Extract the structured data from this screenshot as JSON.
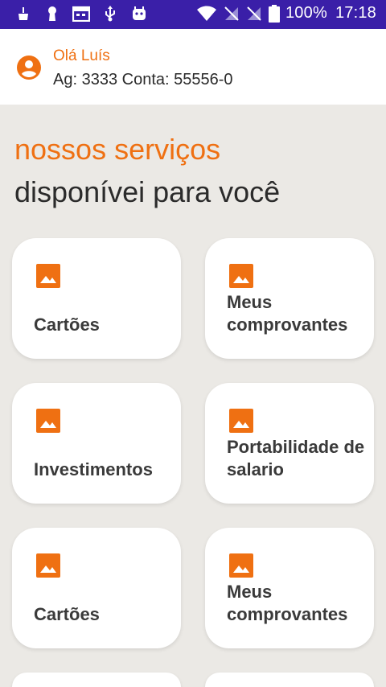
{
  "status_bar": {
    "icons_left": [
      "cleaning-icon",
      "keyhole-icon",
      "calendar-icon",
      "usb-icon",
      "android-icon"
    ],
    "icons_right": [
      "wifi-icon",
      "no-sim-icon",
      "no-sim-icon",
      "battery-icon"
    ],
    "battery": "100%",
    "time": "17:18"
  },
  "header": {
    "greeting": "Olá Luís",
    "account": "Ag: 3333 Conta: 55556-0",
    "accent_color": "#ef7012"
  },
  "section": {
    "title": "nossos serviços",
    "subtitle": "disponívei para você"
  },
  "services": [
    {
      "label": "Cartões"
    },
    {
      "label": "Meus comprovantes"
    },
    {
      "label": "Investimentos"
    },
    {
      "label": "Portabilidade de salario"
    },
    {
      "label": "Cartões"
    },
    {
      "label": "Meus comprovantes"
    }
  ],
  "colors": {
    "status_bar": "#3a1fa8",
    "background": "#ebe9e5",
    "accent": "#ef7012"
  }
}
